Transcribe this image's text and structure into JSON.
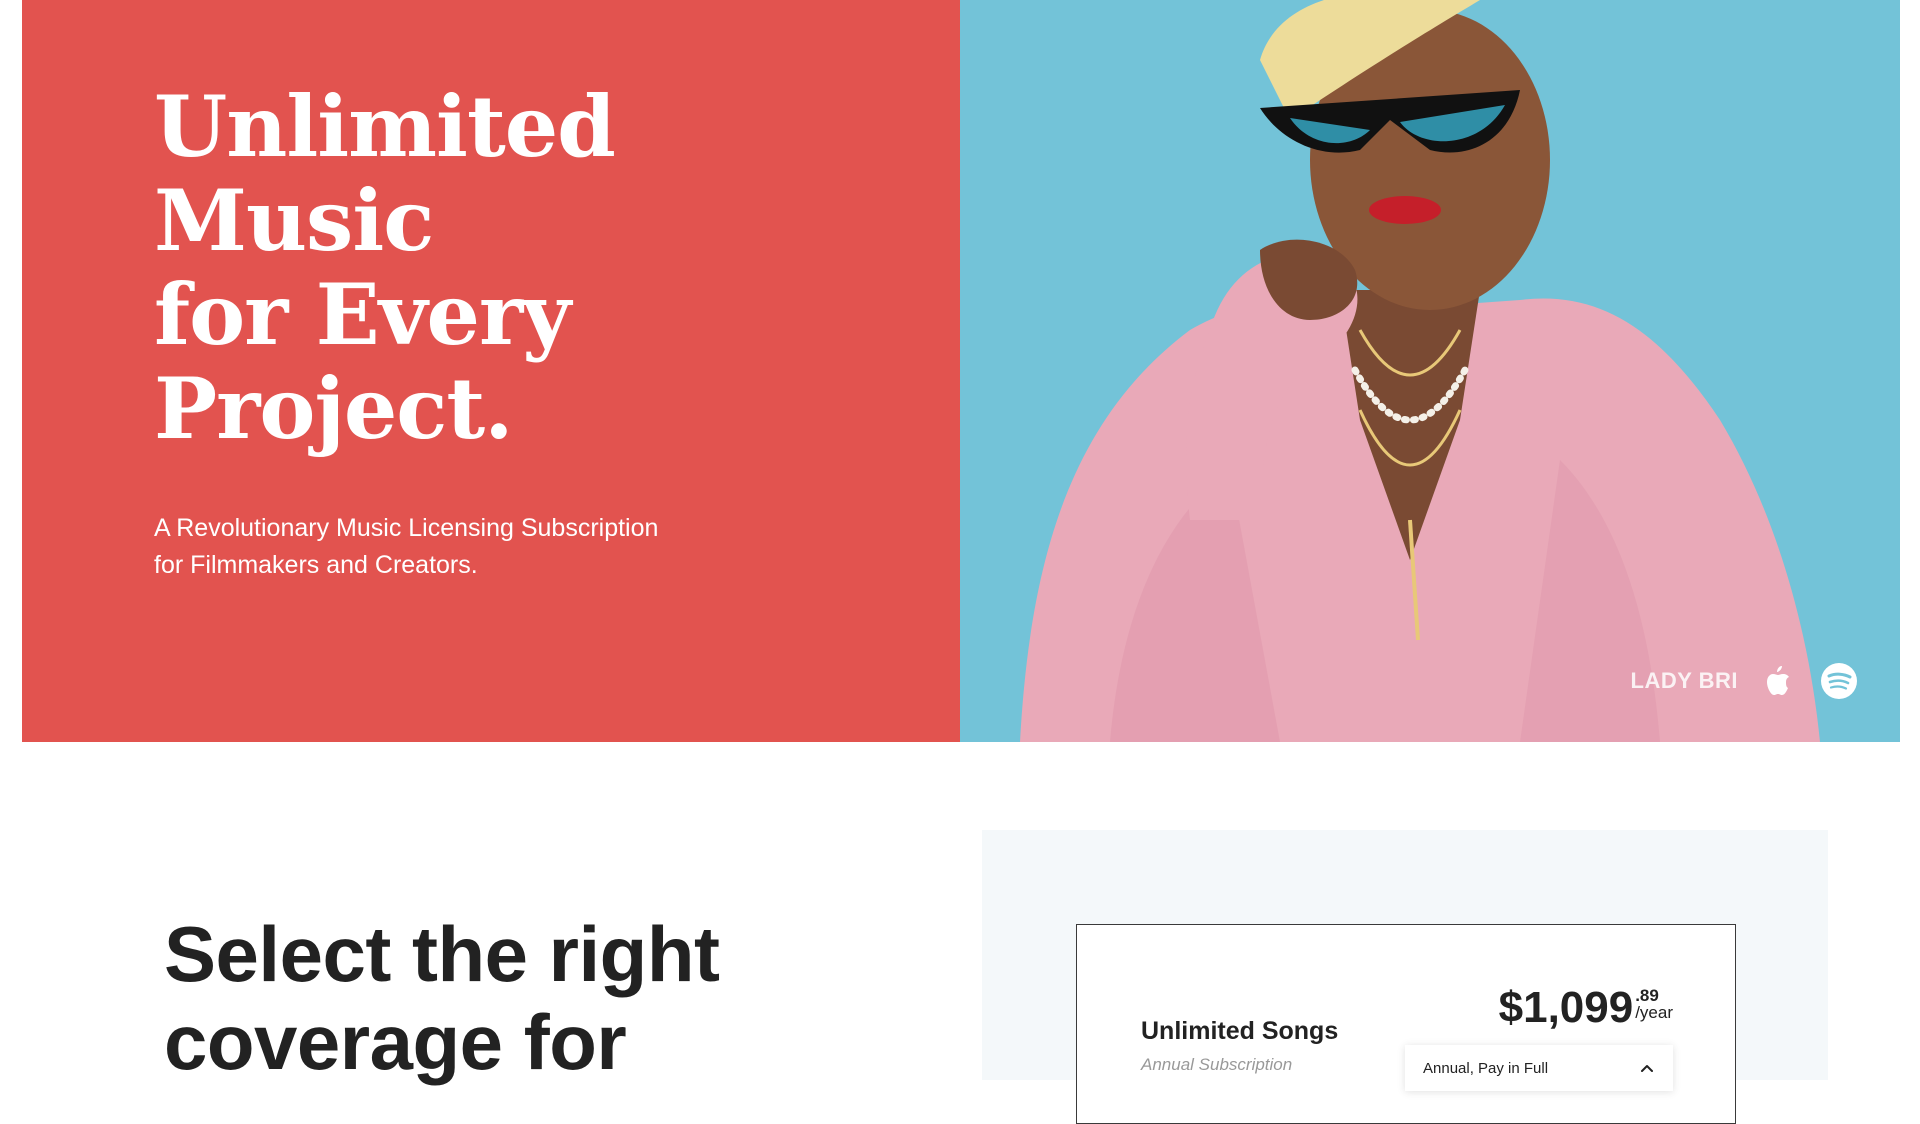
{
  "hero": {
    "title_lines": [
      "Unlimited",
      "Music",
      "for Every",
      "Project."
    ],
    "subtitle_lines": [
      "A Revolutionary Music Licensing Subscription",
      "for Filmmakers and Creators."
    ],
    "artist_name": "LADY BRI",
    "icons": [
      "apple-music-icon",
      "spotify-icon"
    ],
    "colors": {
      "panel": "#E2534F",
      "photo_background": "#73C3D8",
      "sweater": "#E9A9B8"
    }
  },
  "section": {
    "heading_lines": [
      "Select the right",
      "coverage for"
    ]
  },
  "pricing": {
    "plan_name": "Unlimited Songs",
    "plan_type": "Annual Subscription",
    "price_dollars": "$1,099",
    "price_cents": ".89",
    "price_period": "/year",
    "billing_option": "Annual, Pay in Full",
    "colors": {
      "panel": "#F4F8FA",
      "card_border": "#3a3a3a"
    }
  }
}
